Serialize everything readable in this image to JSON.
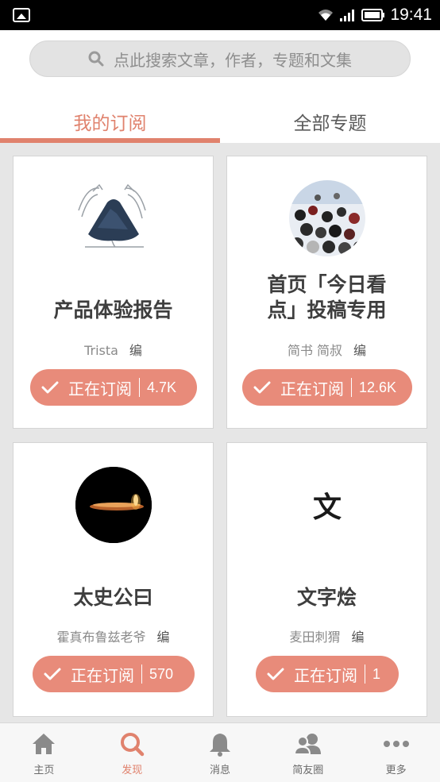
{
  "status_bar": {
    "time": "19:41"
  },
  "search": {
    "placeholder": "点此搜索文章，作者，专题和文集"
  },
  "tabs": [
    {
      "label": "我的订阅",
      "active": true
    },
    {
      "label": "全部专题",
      "active": false
    }
  ],
  "cards": [
    {
      "title_line1": "产品体验报告",
      "title_line2": "",
      "author": "Trista",
      "edit_label": "编",
      "sub_label": "正在订阅",
      "count": "4.7K",
      "avatar": "pencil-sketch-icon"
    },
    {
      "title_line1": "首页「今日看",
      "title_line2": "点」投稿专用",
      "author": "简书 简叔",
      "edit_label": "编",
      "sub_label": "正在订阅",
      "count": "12.6K",
      "avatar": "crowd-photo"
    },
    {
      "title_line1": "太史公曰",
      "title_line2": "",
      "author": "霍真布鲁兹老爷",
      "edit_label": "编",
      "sub_label": "正在订阅",
      "count": "570",
      "avatar": "candle-photo"
    },
    {
      "title_line1": "文字烩",
      "title_line2": "",
      "author": "麦田刺猬",
      "edit_label": "编",
      "sub_label": "正在订阅",
      "count": "1",
      "avatar": "wen-character"
    }
  ],
  "avatar_glyph": "文",
  "bottom_nav": [
    {
      "label": "主页",
      "icon": "home-icon",
      "active": false
    },
    {
      "label": "发现",
      "icon": "search-icon",
      "active": true
    },
    {
      "label": "消息",
      "icon": "bell-icon",
      "active": false
    },
    {
      "label": "简友圈",
      "icon": "friends-icon",
      "active": false
    },
    {
      "label": "更多",
      "icon": "more-icon",
      "active": false
    }
  ],
  "colors": {
    "accent": "#e0826d",
    "button": "#e88b7a",
    "background": "#e6e6e6"
  }
}
